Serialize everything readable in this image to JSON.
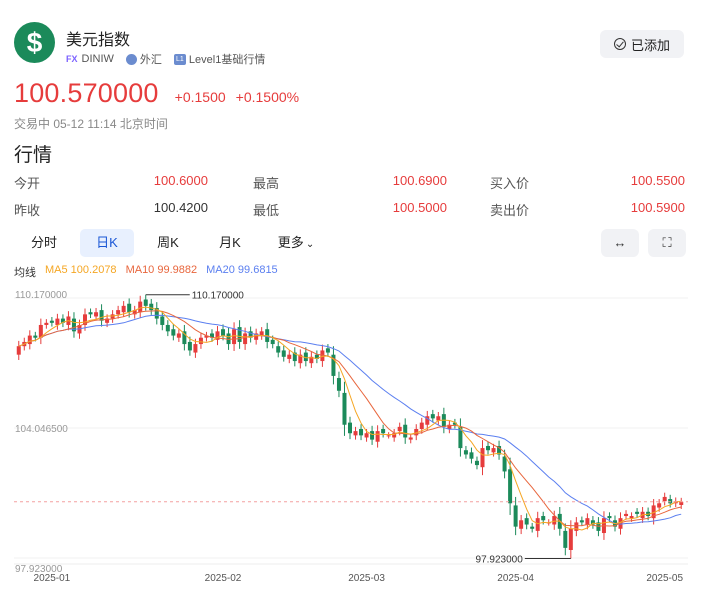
{
  "header": {
    "logo_symbol": "$",
    "title": "美元指数",
    "tag_fx": "FX",
    "ticker": "DINIW",
    "market": "外汇",
    "level_icon_text": "L1",
    "level": "Level1基础行情",
    "added_label": "已添加"
  },
  "quote": {
    "price": "100.570000",
    "change": "+0.1500",
    "change_pct": "+0.1500%",
    "status": "交易中 05-12 11:14 北京时间"
  },
  "section_title": "行情",
  "stats": {
    "open_label": "今开",
    "open": "100.6000",
    "high_label": "最高",
    "high": "100.6900",
    "bid_label": "买入价",
    "bid": "100.5500",
    "prev_label": "昨收",
    "prev": "100.4200",
    "low_label": "最低",
    "low": "100.5000",
    "ask_label": "卖出价",
    "ask": "100.5900"
  },
  "periods": {
    "intraday": "分时",
    "daily": "日K",
    "weekly": "周K",
    "monthly": "月K",
    "more": "更多",
    "active": "daily"
  },
  "toolbar": {
    "expand_icon": "horizontal-expand-icon",
    "fullscreen_icon": "fullscreen-icon"
  },
  "ma": {
    "label": "均线",
    "ma5": "MA5 100.2078",
    "ma10": "MA10 99.9882",
    "ma20": "MA20 99.6815",
    "colors": {
      "ma5": "#f5a623",
      "ma10": "#e8663d",
      "ma20": "#5b7ff0"
    }
  },
  "chart_data": {
    "type": "candlestick",
    "y_ticks": [
      "110.170000",
      "104.046500",
      "97.923000"
    ],
    "ylim": [
      97.923,
      110.17
    ],
    "x_ticks": [
      "2025-01",
      "2025-02",
      "2025-03",
      "2025-04",
      "2025-05"
    ],
    "x_tick_index": [
      6,
      37,
      63,
      90,
      117
    ],
    "max_label": "110.170000",
    "min_label": "97.923000",
    "last_price_line": 100.57,
    "colors": {
      "up": "#e63c3c",
      "down": "#1b8a5a"
    },
    "close": [
      107.9,
      108.1,
      108.4,
      108.3,
      108.9,
      109.0,
      109.0,
      109.2,
      109.0,
      109.3,
      108.6,
      108.9,
      109.4,
      109.4,
      109.5,
      109.1,
      109.2,
      109.4,
      109.6,
      109.8,
      109.5,
      109.6,
      110.0,
      109.8,
      109.6,
      109.2,
      108.9,
      108.6,
      108.4,
      108.5,
      108.0,
      107.7,
      108.0,
      108.3,
      108.4,
      108.3,
      108.6,
      108.4,
      108.0,
      108.7,
      108.1,
      108.5,
      108.3,
      108.5,
      108.6,
      108.1,
      108.0,
      107.6,
      107.4,
      107.5,
      107.2,
      107.5,
      107.2,
      107.4,
      107.3,
      107.7,
      107.6,
      106.5,
      105.8,
      104.2,
      103.8,
      103.9,
      103.7,
      103.8,
      103.5,
      103.9,
      103.8,
      103.7,
      103.8,
      104.1,
      103.6,
      103.6,
      104.0,
      104.3,
      104.6,
      104.5,
      104.6,
      104.1,
      104.2,
      104.2,
      103.1,
      102.8,
      102.6,
      102.3,
      103.1,
      103.0,
      103.1,
      102.8,
      102.0,
      100.5,
      99.4,
      99.7,
      99.5,
      99.3,
      99.8,
      99.7,
      99.6,
      99.9,
      99.3,
      98.4,
      99.3,
      99.6,
      99.6,
      99.8,
      99.5,
      99.2,
      99.8,
      99.8,
      99.4,
      99.8,
      100.0,
      99.9,
      100.0,
      100.1,
      99.9,
      100.4,
      100.5,
      100.8,
      100.5,
      100.6,
      100.57
    ],
    "open": [
      107.5,
      107.9,
      108.0,
      108.4,
      108.3,
      108.9,
      109.1,
      108.9,
      109.2,
      108.9,
      109.2,
      108.5,
      108.9,
      109.5,
      109.3,
      109.6,
      109.0,
      109.2,
      109.4,
      109.5,
      109.9,
      109.4,
      109.5,
      110.1,
      109.9,
      109.7,
      109.3,
      108.9,
      108.7,
      108.3,
      108.6,
      108.1,
      107.6,
      108.0,
      108.3,
      108.5,
      108.2,
      108.7,
      108.5,
      108.0,
      108.8,
      108.0,
      108.6,
      108.2,
      108.4,
      108.7,
      108.2,
      107.9,
      107.7,
      107.3,
      107.6,
      107.1,
      107.6,
      107.1,
      107.5,
      107.2,
      107.8,
      107.5,
      106.4,
      105.7,
      104.3,
      103.7,
      104.0,
      103.6,
      103.9,
      103.4,
      104.0,
      103.7,
      103.6,
      103.9,
      104.2,
      103.5,
      103.7,
      104.0,
      104.2,
      104.7,
      104.4,
      104.7,
      104.0,
      104.3,
      104.1,
      103.0,
      102.9,
      102.5,
      102.2,
      103.2,
      102.9,
      103.2,
      102.7,
      102.1,
      100.4,
      99.3,
      99.8,
      99.4,
      99.2,
      99.9,
      99.6,
      99.5,
      100.0,
      99.2,
      98.3,
      99.2,
      99.7,
      99.5,
      99.7,
      99.6,
      99.1,
      99.9,
      99.7,
      99.3,
      99.9,
      99.8,
      100.1,
      99.8,
      100.1,
      99.8,
      100.3,
      100.6,
      100.7,
      100.5,
      100.42
    ]
  }
}
